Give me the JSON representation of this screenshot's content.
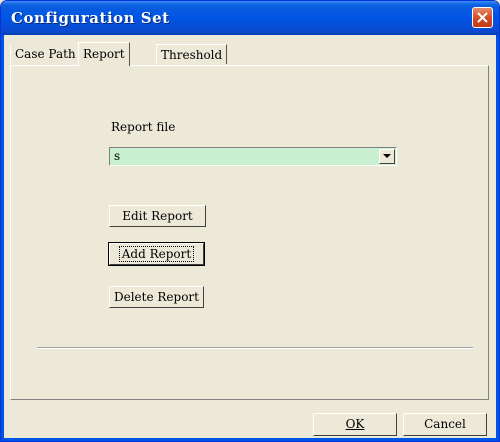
{
  "window": {
    "title": "Configuration Set",
    "close_icon": "close-icon"
  },
  "tabs": [
    {
      "label": "Case Path",
      "selected": false
    },
    {
      "label": "Report",
      "selected": true
    },
    {
      "label": "Threshold",
      "selected": false
    }
  ],
  "report": {
    "file_label": "Report file",
    "file_value": "s",
    "edit_label": "Edit Report",
    "add_label": "Add Report",
    "delete_label": "Delete Report"
  },
  "footer": {
    "ok_label": "OK",
    "cancel_label": "Cancel"
  },
  "colors": {
    "title_bar": "#0054e3",
    "combo_bg": "#c8f0d0",
    "close_button": "#d24a22"
  }
}
